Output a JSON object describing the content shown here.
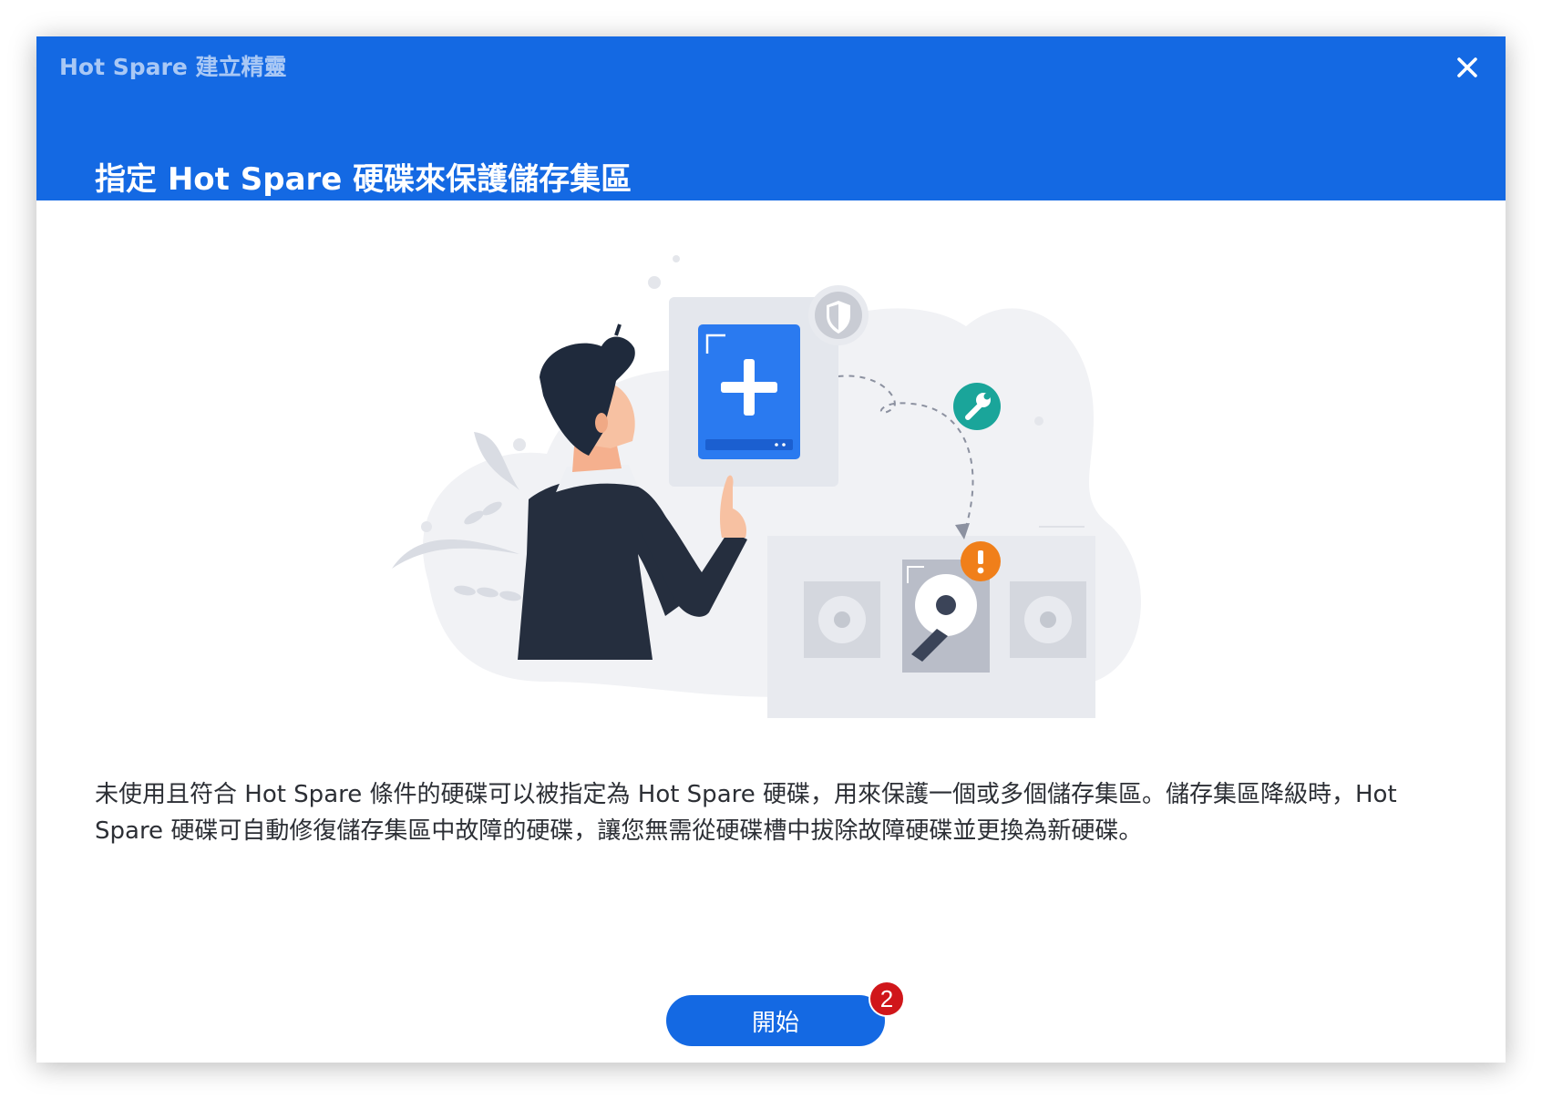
{
  "window": {
    "title": "Hot Spare 建立精靈",
    "close_icon": "close-icon"
  },
  "header": {
    "heading": "指定 Hot Spare 硬碟來保護儲存集區"
  },
  "body": {
    "description": "未使用且符合 Hot Spare 條件的硬碟可以被指定為 Hot Spare 硬碟，用來保護一個或多個儲存集區。儲存集區降級時，Hot Spare 硬碟可自動修復儲存集區中故障的硬碟，讓您無需從硬碟槽中拔除故障硬碟並更換為新硬碟。"
  },
  "footer": {
    "start_label": "開始",
    "step_badge": "2"
  },
  "colors": {
    "header_blue": "#1469e3",
    "badge_red": "#d0161a",
    "warning_orange": "#f07f1a",
    "wrench_teal": "#1aa59a"
  },
  "icons": [
    "close-icon",
    "plus-icon",
    "shield-icon",
    "wrench-icon",
    "warning-icon",
    "hard-disk-icon"
  ]
}
